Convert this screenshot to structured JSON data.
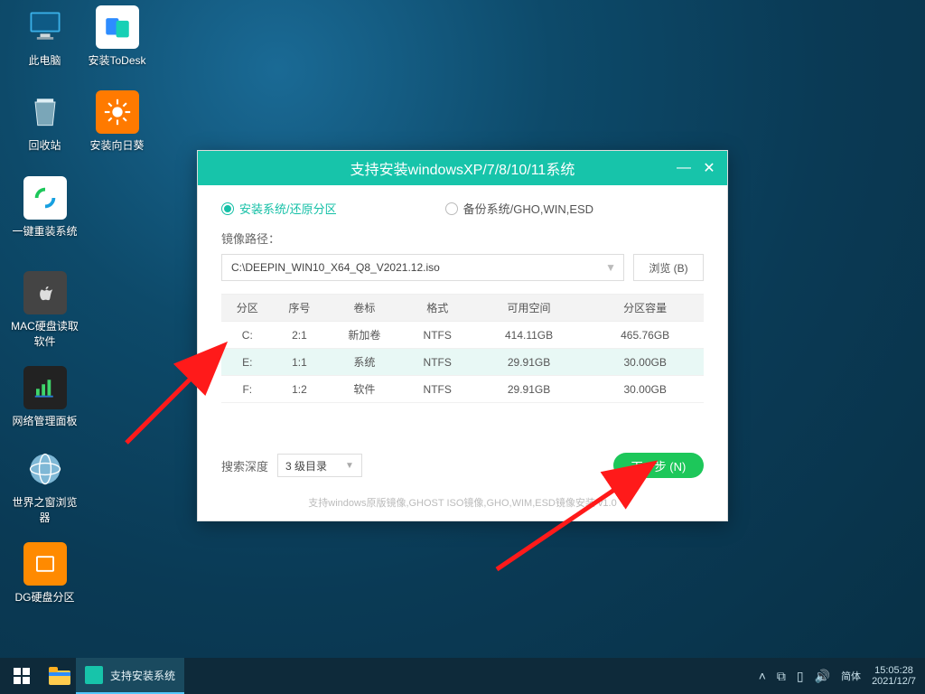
{
  "desktop_icons": {
    "this_pc": "此电脑",
    "todesk": "安装ToDesk",
    "recycle": "回收站",
    "sunlogin": "安装向日葵",
    "reinstall": "一键重装系统",
    "mac_reader": "MAC硬盘读取软件",
    "net_panel": "网络管理面板",
    "world_browser": "世界之窗浏览器",
    "dg": "DG硬盘分区"
  },
  "window": {
    "title": "支持安装windowsXP/7/8/10/11系统",
    "tab_install": "安装系统/还原分区",
    "tab_backup": "备份系统/GHO,WIN,ESD",
    "path_label": "镜像路径：",
    "iso_path": "C:\\DEEPIN_WIN10_X64_Q8_V2021.12.iso",
    "browse": "浏览 (B)",
    "table": {
      "headers": [
        "分区",
        "序号",
        "卷标",
        "格式",
        "可用空间",
        "分区容量"
      ],
      "rows": [
        {
          "drive": "C:",
          "idx": "2:1",
          "label": "新加卷",
          "fs": "NTFS",
          "free": "414.11GB",
          "total": "465.76GB",
          "sel": false
        },
        {
          "drive": "E:",
          "idx": "1:1",
          "label": "系统",
          "fs": "NTFS",
          "free": "29.91GB",
          "total": "30.00GB",
          "sel": true
        },
        {
          "drive": "F:",
          "idx": "1:2",
          "label": "软件",
          "fs": "NTFS",
          "free": "29.91GB",
          "total": "30.00GB",
          "sel": false
        }
      ]
    },
    "depth_label": "搜索深度",
    "depth_value": "3 级目录",
    "next": "下一步 (N)",
    "footer": "支持windows原版镜像,GHOST ISO镜像,GHO,WIM,ESD镜像安装  v1.0"
  },
  "taskbar": {
    "active_app": "支持安装系统",
    "ime": "简体",
    "time": "15:05:28",
    "date": "2021/12/7"
  }
}
